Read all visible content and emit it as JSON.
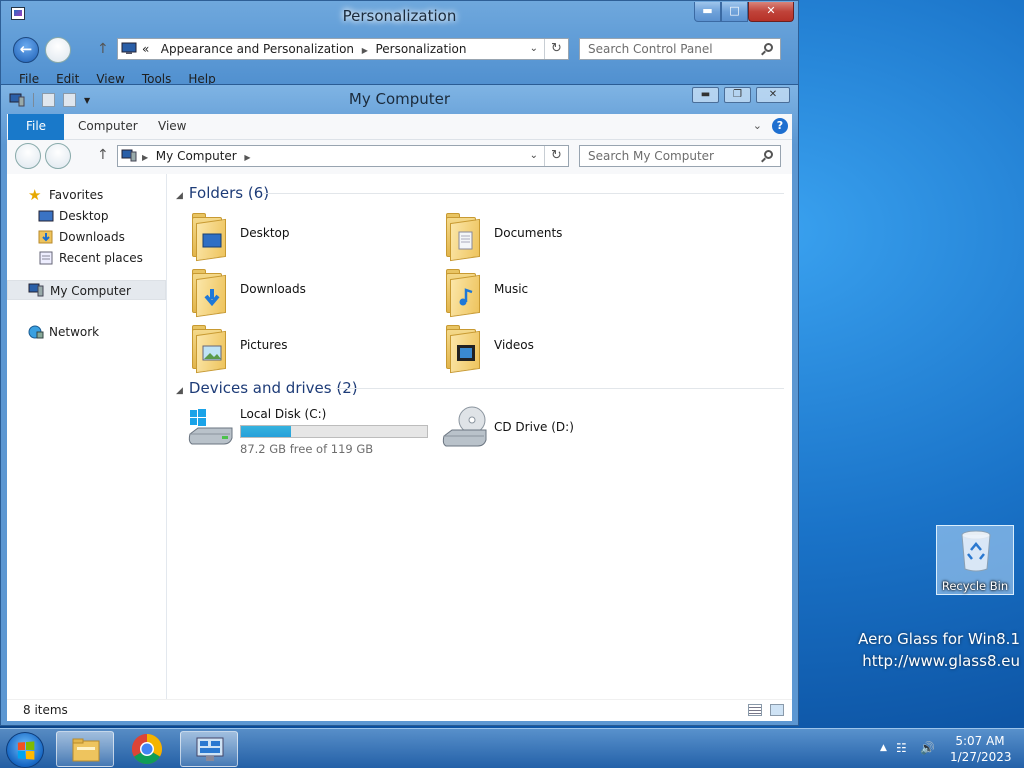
{
  "desktop": {
    "recycle_bin_label": "Recycle Bin",
    "watermark_line1": "Aero Glass for Win8.1",
    "watermark_line2": "http://www.glass8.eu"
  },
  "back_window": {
    "title": "Personalization",
    "breadcrumb_prefix": "«",
    "breadcrumb": [
      "Appearance and Personalization",
      "Personalization"
    ],
    "search_placeholder": "Search Control Panel",
    "menu": [
      "File",
      "Edit",
      "View",
      "Tools",
      "Help"
    ]
  },
  "front_window": {
    "title": "My Computer",
    "ribbon_tabs": [
      "File",
      "Computer",
      "View"
    ],
    "address": "My Computer",
    "search_placeholder": "Search My Computer",
    "nav_pane": {
      "favorites_label": "Favorites",
      "favorites": [
        "Desktop",
        "Downloads",
        "Recent places"
      ],
      "computer_label": "My Computer",
      "network_label": "Network"
    },
    "folders_header": "Folders (6)",
    "folders": [
      {
        "name": "Desktop",
        "icon": "desktop-folder-icon"
      },
      {
        "name": "Documents",
        "icon": "documents-folder-icon"
      },
      {
        "name": "Downloads",
        "icon": "downloads-folder-icon"
      },
      {
        "name": "Music",
        "icon": "music-folder-icon"
      },
      {
        "name": "Pictures",
        "icon": "pictures-folder-icon"
      },
      {
        "name": "Videos",
        "icon": "videos-folder-icon"
      }
    ],
    "drives_header": "Devices and drives (2)",
    "drives": [
      {
        "name": "Local Disk (C:)",
        "free_text": "87.2 GB free of 119 GB",
        "used_fraction": 0.27
      },
      {
        "name": "CD Drive (D:)"
      }
    ],
    "status_text": "8 items"
  },
  "taskbar": {
    "time": "5:07 AM",
    "date": "1/27/2023",
    "pinned": [
      "File Explorer",
      "Google Chrome",
      "Control Panel"
    ]
  }
}
